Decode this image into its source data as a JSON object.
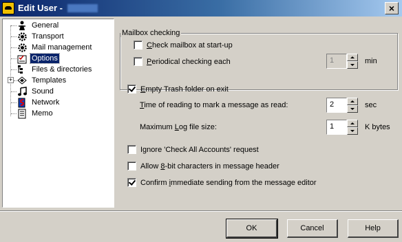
{
  "window": {
    "title": "Edit User -",
    "close_glyph": "×"
  },
  "tree": {
    "items": [
      {
        "label": "General",
        "icon": "person-icon"
      },
      {
        "label": "Transport",
        "icon": "gear-icon"
      },
      {
        "label": "Mail management",
        "icon": "gear-icon"
      },
      {
        "label": "Options",
        "icon": "options-icon",
        "selected": true
      },
      {
        "label": "Files & directories",
        "icon": "files-icon"
      },
      {
        "label": "Templates",
        "icon": "templates-icon",
        "expandable": true
      },
      {
        "label": "Sound",
        "icon": "music-note-icon"
      },
      {
        "label": "Network",
        "icon": "network-icon"
      },
      {
        "label": "Memo",
        "icon": "memo-icon"
      }
    ],
    "expander_glyph": "+"
  },
  "options": {
    "mailbox_group_title": "Mailbox checking",
    "check_at_startup": {
      "pre": "",
      "key": "C",
      "post": "heck mailbox at start-up",
      "checked": false
    },
    "periodical": {
      "pre": "",
      "key": "P",
      "post": "eriodical checking each",
      "checked": false,
      "value": "1",
      "unit": "min"
    },
    "empty_trash": {
      "pre": "",
      "key": "E",
      "post": "mpty Trash folder on exit",
      "checked": true
    },
    "read_time": {
      "pre": "",
      "key": "T",
      "post": "ime of reading to mark a message as read:",
      "value": "2",
      "unit": "sec"
    },
    "max_log": {
      "pre": "Maximum ",
      "key": "L",
      "post": "og file size:",
      "value": "1",
      "unit": "K bytes"
    },
    "ignore_check_all": {
      "text": "Ignore 'Check All Accounts' request",
      "checked": false
    },
    "allow_8bit": {
      "pre": "Allow ",
      "key": "8",
      "post": "-bit characters in message header",
      "checked": false
    },
    "confirm_immediate": {
      "pre": "Confirm ",
      "key": "i",
      "post": "mmediate sending from the message editor",
      "checked": true
    }
  },
  "buttons": {
    "ok": "OK",
    "cancel": "Cancel",
    "help": "Help"
  },
  "colors": {
    "title_start": "#0a246a",
    "title_end": "#a6caf0",
    "face": "#d4d0c8",
    "selection": "#0a246a"
  }
}
